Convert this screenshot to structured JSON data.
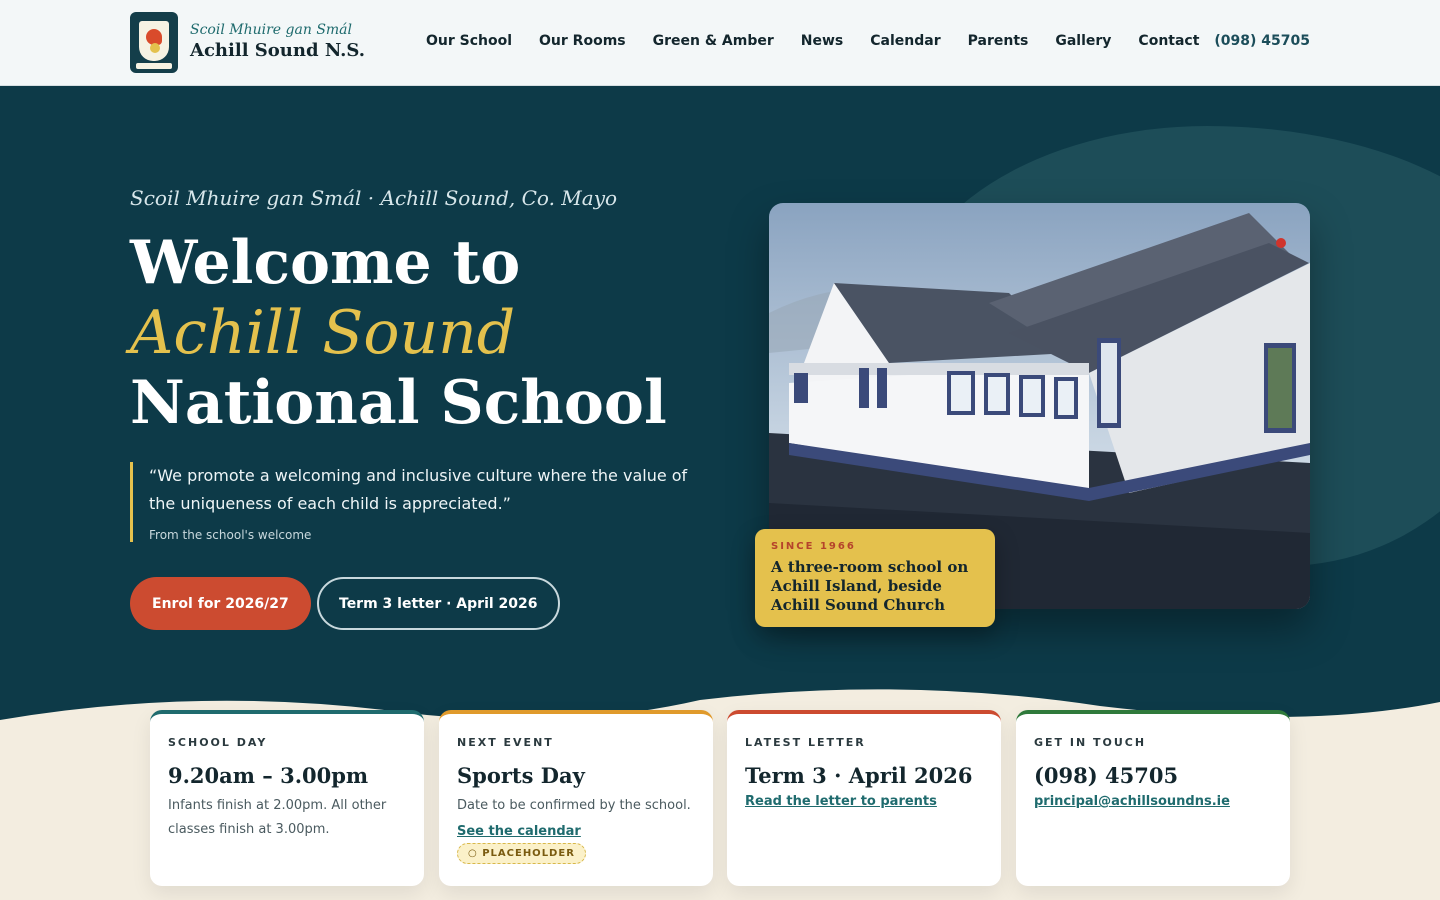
{
  "header": {
    "brand_subtitle": "Scoil Mhuire gan Smál",
    "brand_title": "Achill Sound N.S.",
    "nav": [
      "Our School",
      "Our Rooms",
      "Green & Amber",
      "News",
      "Calendar",
      "Parents",
      "Gallery",
      "Contact"
    ],
    "phone": "(098) 45705"
  },
  "hero": {
    "eyebrow": "Scoil Mhuire gan Smál · Achill Sound, Co. Mayo",
    "headline_part1": "Welcome to ",
    "headline_highlight": "Achill Sound",
    "headline_part2": " National School",
    "quote": "“We promote a welcoming and inclusive culture where the value of the uniqueness of each child is appreciated.”",
    "quote_source": "From the school's welcome",
    "primary_button": "Enrol for 2026/27",
    "secondary_button": "Term 3 letter · April 2026",
    "badge_since": "SINCE 1966",
    "badge_text": "A three-room school on Achill Island, beside Achill Sound Church"
  },
  "cards": [
    {
      "label": "SCHOOL DAY",
      "title": "9.20am – 3.00pm",
      "desc": "Infants finish at 2.00pm. All other classes finish at 3.00pm."
    },
    {
      "label": "NEXT EVENT",
      "title": "Sports Day",
      "desc": "Date to be confirmed by the school.",
      "link": "See the calendar",
      "tag": "○ PLACEHOLDER"
    },
    {
      "label": "LATEST LETTER",
      "title": "Term 3 · April 2026",
      "link": "Read the letter to parents"
    },
    {
      "label": "GET IN TOUCH",
      "title": "(098) 45705",
      "link": "principal@achillsoundns.ie"
    }
  ],
  "colors": {
    "hero_bg": "#0d3a48",
    "accent_yellow": "#e4c14d",
    "accent_red": "#cc4b30",
    "cream": "#f3ede0"
  }
}
